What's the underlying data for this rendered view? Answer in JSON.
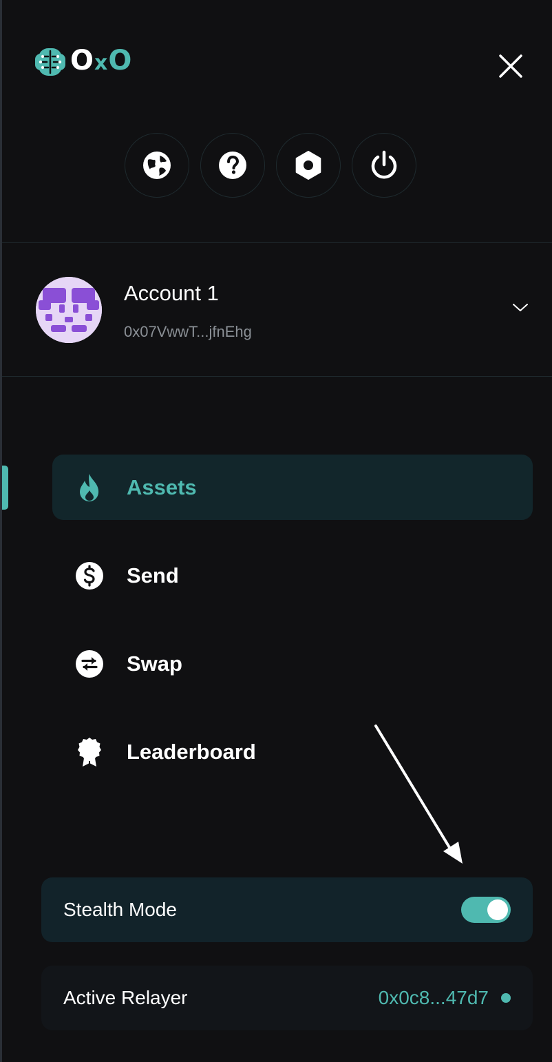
{
  "header": {
    "logo_text_left": "O",
    "logo_text_x": "x",
    "logo_text_right": "O",
    "close_icon": "close-icon"
  },
  "toolbar": {
    "buttons": [
      {
        "icon": "globe-icon"
      },
      {
        "icon": "help-icon"
      },
      {
        "icon": "settings-icon"
      },
      {
        "icon": "power-icon"
      }
    ]
  },
  "account": {
    "name": "Account 1",
    "address": "0x07VwwT...jfnEhg",
    "avatar_colors": {
      "background": "#e6d6f6",
      "foreground": "#8a4fd6"
    }
  },
  "nav": {
    "items": [
      {
        "label": "Assets",
        "icon": "flame-icon",
        "active": true
      },
      {
        "label": "Send",
        "icon": "dollar-icon",
        "active": false
      },
      {
        "label": "Swap",
        "icon": "swap-icon",
        "active": false
      },
      {
        "label": "Leaderboard",
        "icon": "badge-icon",
        "active": false
      }
    ]
  },
  "stealth": {
    "label": "Stealth Mode",
    "enabled": true
  },
  "relayer": {
    "label": "Active Relayer",
    "value": "0x0c8...47d7"
  },
  "colors": {
    "accent": "#4fb9b0",
    "background": "#101012",
    "card": "#12232a"
  }
}
